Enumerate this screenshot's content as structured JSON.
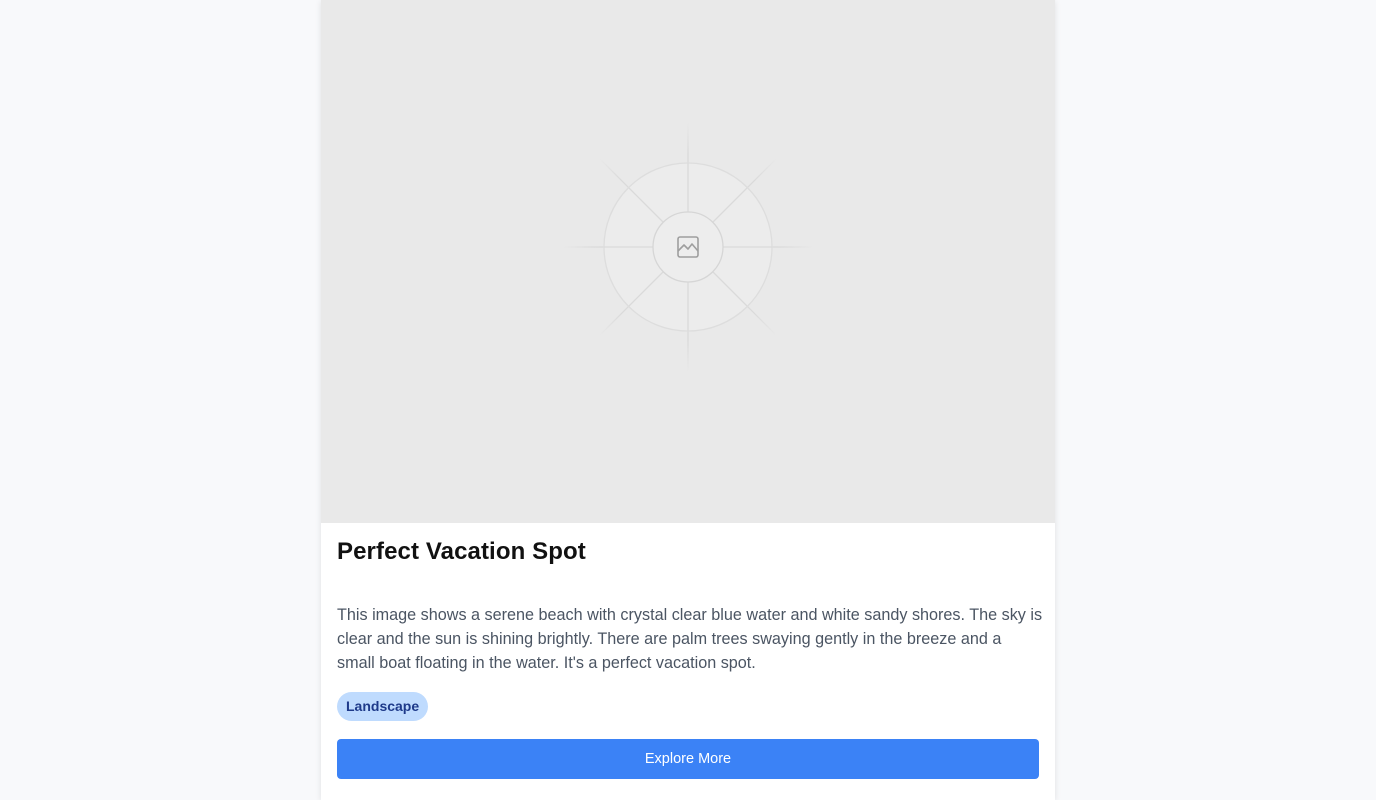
{
  "card": {
    "image_icon": "image-placeholder-icon",
    "title": "Perfect Vacation Spot",
    "description": "This image shows a serene beach with crystal clear blue water and white sandy shores. The sky is clear and the sun is shining brightly. There are palm trees swaying gently in the breeze and a small boat floating in the water. It's a perfect vacation spot.",
    "tag": "Landscape",
    "button_label": "Explore More"
  },
  "colors": {
    "page_background": "#f8f9fb",
    "image_placeholder": "#e9e9e9",
    "tag_background": "#bfdbfe",
    "tag_text": "#1e3a8a",
    "button_background": "#3b82f6"
  }
}
